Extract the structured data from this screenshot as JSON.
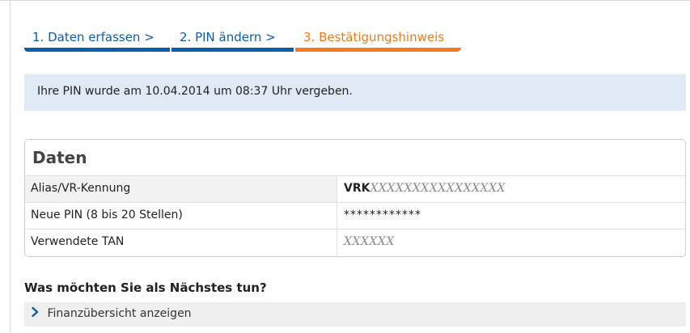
{
  "wizard": {
    "steps": [
      {
        "label": "1. Daten erfassen  >"
      },
      {
        "label": "2. PIN ändern  >"
      },
      {
        "label": "3. Bestätigungshinweis"
      }
    ],
    "colors": {
      "done": "#0b5ea8",
      "active": "#f57a1f"
    }
  },
  "info_message": "Ihre PIN wurde am 10.04.2014 um 08:37 Uhr vergeben.",
  "data_panel": {
    "title": "Daten",
    "rows": [
      {
        "label": "Alias/VR-Kennung",
        "value_prefix": "VRK",
        "value": "XXXXXXXXXXXXXXXX"
      },
      {
        "label": "Neue PIN (8 bis 20 Stellen)",
        "value": "************"
      },
      {
        "label": "Verwendete TAN",
        "value": "XXXXXX"
      }
    ]
  },
  "next_steps": {
    "title": "Was möchten Sie als Nächstes tun?",
    "items": [
      {
        "label": "Finanzübersicht anzeigen",
        "icon": "chevron-right-icon"
      }
    ]
  }
}
